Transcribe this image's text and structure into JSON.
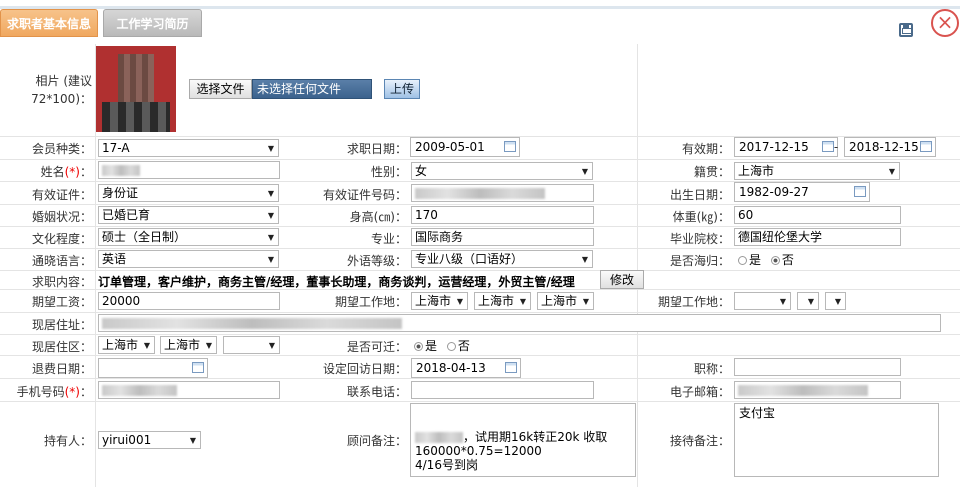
{
  "tabs": {
    "basic_info": "求职者基本信息",
    "work_history": "工作学习简历"
  },
  "labels": {
    "photo": "相片 (建议72*100)：",
    "member_type": "会员种类：",
    "job_date": "求职日期：",
    "validity": "有效期：",
    "name": "姓名",
    "name_req": "(*)",
    "gender": "性别：",
    "native_place": "籍贯：",
    "id_type": "有效证件：",
    "id_number": "有效证件号码：",
    "birth_date": "出生日期：",
    "marital": "婚姻状况：",
    "height": "身高(㎝)：",
    "weight": "体重(㎏)：",
    "education": "文化程度：",
    "major": "专业：",
    "school": "毕业院校：",
    "language": "通晓语言：",
    "foreign_level": "外语等级：",
    "returnee": "是否海归：",
    "job_content": "求职内容：",
    "salary": "期望工资：",
    "work_place": "期望工作地：",
    "work_place2": "期望工作地：",
    "address": "现居住址：",
    "district": "现居住区：",
    "relocate": "是否可迁：",
    "refund_date": "退费日期：",
    "revisit_date": "设定回访日期：",
    "title": "职称：",
    "mobile": "手机号码",
    "mobile_req": "(*)",
    "phone": "联系电话：",
    "email": "电子邮箱：",
    "holder": "持有人：",
    "advisor_note": "顾问备注：",
    "reception_note": "接待备注："
  },
  "photo_upload": {
    "choose_file": "选择文件",
    "no_file": "未选择任何文件",
    "upload": "上传"
  },
  "values": {
    "member_type": "17-A",
    "job_date": "2009-05-01",
    "validity_from": "2017-12-15",
    "validity_sep": "-",
    "validity_to": "2018-12-15",
    "gender": "女",
    "native_place": "上海市",
    "id_type": "身份证",
    "birth_date": "1982-09-27",
    "marital": "已婚已育",
    "height": "170",
    "weight": "60",
    "education": "硕士（全日制）",
    "major": "国际商务",
    "school": "德国纽伦堡大学",
    "language": "英语",
    "foreign_level": "专业八级（口语好）",
    "returnee_yes": "是",
    "returnee_no": "否",
    "job_content": "订单管理，客户维护，商务主管/经理，董事长助理，商务谈判，运营经理，外贸主管/经理",
    "modify": "修改",
    "salary": "20000",
    "work_place_1": "上海市",
    "work_place_2": "上海市",
    "work_place_3": "上海市",
    "district_1": "上海市",
    "district_2": "上海市",
    "relocate_yes": "是",
    "relocate_no": "否",
    "revisit_date": "2018-04-13",
    "holder": "yirui001",
    "advisor_note_line1": "，试用期16k转正20k 收取",
    "advisor_note_line2": "160000*0.75=12000",
    "advisor_note_line3": "4/16号到岗",
    "reception_note": "支付宝"
  },
  "colors": {
    "tab_active": "#f0a860",
    "tab_inactive": "#b9b9b9",
    "required": "#ee0000",
    "close": "#d9534f"
  }
}
